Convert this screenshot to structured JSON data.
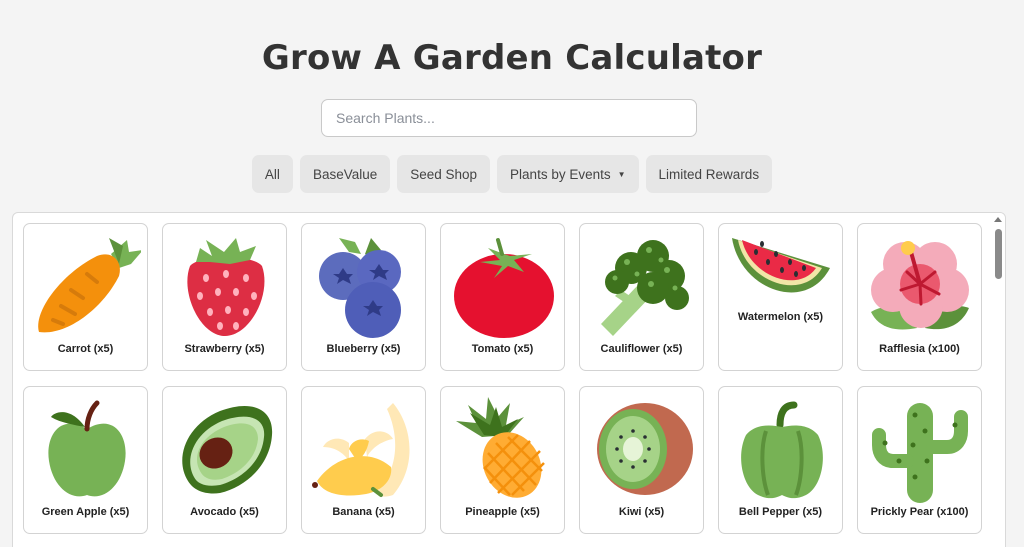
{
  "header": {
    "title": "Grow A Garden Calculator"
  },
  "search": {
    "placeholder": "Search Plants..."
  },
  "filters": [
    {
      "label": "All"
    },
    {
      "label": "BaseValue"
    },
    {
      "label": "Seed Shop"
    },
    {
      "label": "Plants by Events",
      "has_dropdown": true
    },
    {
      "label": "Limited Rewards"
    }
  ],
  "plants": [
    {
      "label": "Carrot (x5)",
      "icon": "carrot-icon"
    },
    {
      "label": "Strawberry (x5)",
      "icon": "strawberry-icon"
    },
    {
      "label": "Blueberry (x5)",
      "icon": "blueberry-icon"
    },
    {
      "label": "Tomato (x5)",
      "icon": "tomato-icon"
    },
    {
      "label": "Cauliflower (x5)",
      "icon": "broccoli-icon"
    },
    {
      "label": "Watermelon (x5)",
      "icon": "watermelon-icon"
    },
    {
      "label": "Rafflesia (x100)",
      "icon": "hibiscus-icon"
    },
    {
      "label": "Green Apple (x5)",
      "icon": "green-apple-icon"
    },
    {
      "label": "Avocado (x5)",
      "icon": "avocado-icon"
    },
    {
      "label": "Banana (x5)",
      "icon": "banana-icon"
    },
    {
      "label": "Pineapple (x5)",
      "icon": "pineapple-icon"
    },
    {
      "label": "Kiwi (x5)",
      "icon": "kiwi-icon"
    },
    {
      "label": "Bell Pepper (x5)",
      "icon": "bell-pepper-icon"
    },
    {
      "label": "Prickly Pear (x100)",
      "icon": "cactus-icon"
    }
  ]
}
